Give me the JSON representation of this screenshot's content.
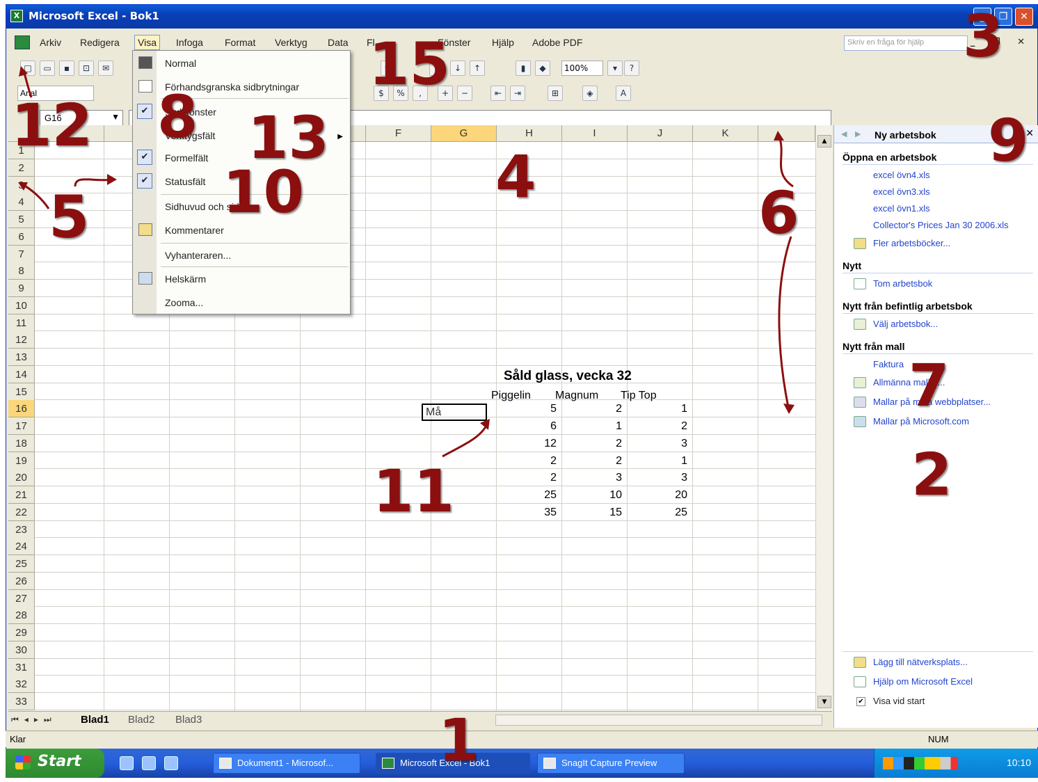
{
  "window": {
    "title": "Microsoft Excel - Bok1"
  },
  "menubar": {
    "items": [
      "Arkiv",
      "Redigera",
      "Visa",
      "Infoga",
      "Format",
      "Verktyg",
      "Data",
      "Fl...",
      "Fönster",
      "Hjälp",
      "Adobe PDF"
    ],
    "help_placeholder": "Skriv en fråga för hjälp"
  },
  "toolbar": {
    "zoom": "100%",
    "font": "Arial"
  },
  "formula_bar": {
    "name_box": "G16"
  },
  "view_menu": {
    "items": [
      {
        "label": "Normal",
        "checked": false,
        "icon": "normal-view-icon"
      },
      {
        "label": "Förhandsgranska sidbrytningar",
        "checked": false,
        "icon": "page-break-icon"
      },
      {
        "label": "...rdsfönster",
        "checked": true,
        "icon": "check-icon"
      },
      {
        "label": "Verktygsfält",
        "checked": false,
        "submenu": true
      },
      {
        "label": "Formelfält",
        "checked": true,
        "icon": "check-icon"
      },
      {
        "label": "Statusfält",
        "checked": true,
        "icon": "check-icon"
      },
      {
        "label": "Sidhuvud och sidfot",
        "checked": false
      },
      {
        "label": "Kommentarer",
        "checked": false,
        "icon": "comment-icon"
      },
      {
        "label": "Vyhanteraren...",
        "checked": false
      },
      {
        "label": "Helskärm",
        "checked": false,
        "icon": "fullscreen-icon"
      },
      {
        "label": "Zooma...",
        "checked": false
      }
    ]
  },
  "grid": {
    "columns": [
      "E",
      "F",
      "G",
      "H",
      "I",
      "J",
      "K"
    ],
    "selected_column": "G",
    "rows": [
      "1",
      "2",
      "3",
      "4",
      "5",
      "6",
      "7",
      "8",
      "9",
      "10",
      "11",
      "12",
      "13",
      "14",
      "15",
      "16",
      "17",
      "18",
      "19",
      "20",
      "21",
      "22",
      "23",
      "24",
      "25",
      "26",
      "27",
      "28",
      "29",
      "30",
      "31",
      "32",
      "33"
    ],
    "selected_row": "16",
    "table_title": "Såld glass, vecka 32",
    "table_headers": [
      "Piggelin",
      "Magnum",
      "Tip Top"
    ],
    "active_cell_text": "Må",
    "table_rows": [
      [
        "5",
        "2",
        "1"
      ],
      [
        "6",
        "1",
        "2"
      ],
      [
        "12",
        "2",
        "3"
      ],
      [
        "2",
        "2",
        "1"
      ],
      [
        "2",
        "3",
        "3"
      ],
      [
        "25",
        "10",
        "20"
      ],
      [
        "35",
        "15",
        "25"
      ]
    ]
  },
  "sheet_tabs": [
    "Blad1",
    "Blad2",
    "Blad3"
  ],
  "status": {
    "text": "Klar",
    "num": "NUM"
  },
  "task_pane": {
    "title": "Ny arbetsbok",
    "open_section": "Öppna en arbetsbok",
    "recent_files": [
      "excel övn4.xls",
      "excel övn3.xls",
      "excel övn1.xls",
      "Collector's Prices Jan 30 2006.xls"
    ],
    "more_workbooks": "Fler arbetsböcker...",
    "new_section": "Nytt",
    "blank_workbook": "Tom arbetsbok",
    "from_existing_section": "Nytt från befintlig arbetsbok",
    "choose_workbook": "Välj arbetsbok...",
    "from_template_section": "Nytt från mall",
    "templates": [
      "Faktura",
      "Allmänna mallar...",
      "Mallar på mina webbplatser...",
      "Mallar på Microsoft.com"
    ],
    "footer_links": [
      "Lägg till nätverksplats...",
      "Hjälp om Microsoft Excel"
    ],
    "show_at_startup": "Visa vid start"
  },
  "taskbar": {
    "start_label": "Start",
    "tasks": [
      "Dokument1 - Microsof...",
      "Microsoft Excel - Bok1",
      "SnagIt Capture Preview"
    ],
    "clock": "10:10"
  },
  "annotations": [
    "1",
    "2",
    "3",
    "4",
    "5",
    "6",
    "7",
    "8",
    "9",
    "10",
    "11",
    "12",
    "13",
    "15"
  ],
  "colors": {
    "annotation": "#8b0f0f",
    "titlebar": "#0a4fc6",
    "selection_header": "#fbd67a",
    "link": "#2244cc"
  }
}
